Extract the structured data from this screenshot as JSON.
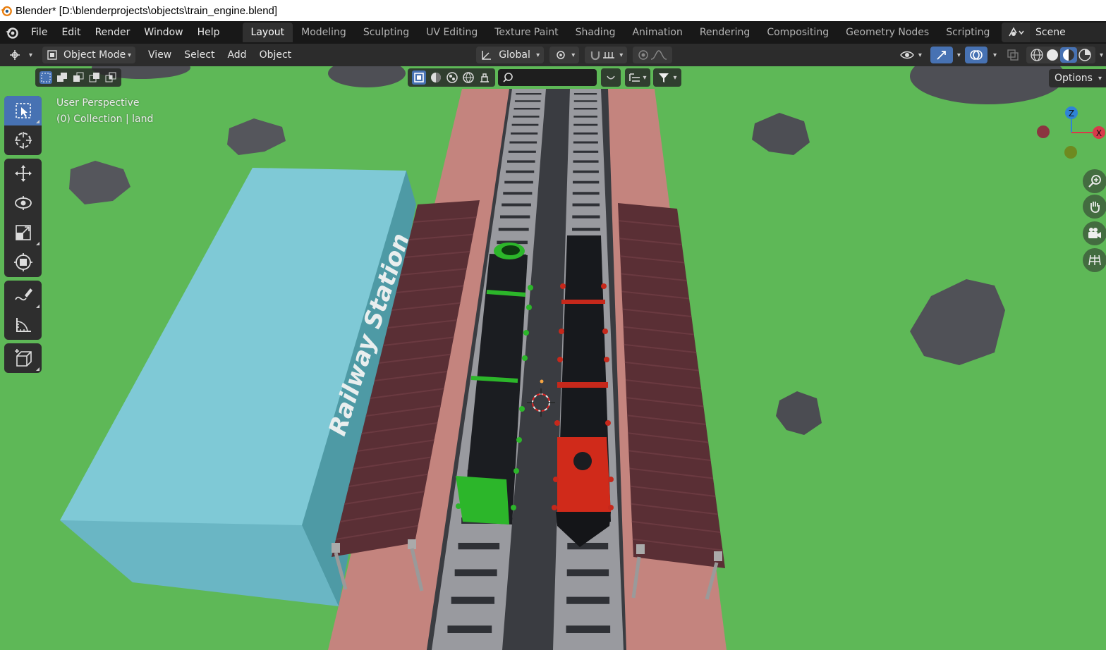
{
  "window": {
    "title": "Blender* [D:\\blenderprojects\\objects\\train_engine.blend]"
  },
  "menu": {
    "items": [
      "File",
      "Edit",
      "Render",
      "Window",
      "Help"
    ]
  },
  "workspaces": {
    "tabs": [
      "Layout",
      "Modeling",
      "Sculpting",
      "UV Editing",
      "Texture Paint",
      "Shading",
      "Animation",
      "Rendering",
      "Compositing",
      "Geometry Nodes",
      "Scripting"
    ],
    "active": "Layout",
    "add_label": "+"
  },
  "scene": {
    "name": "Scene"
  },
  "header": {
    "mode": "Object Mode",
    "menus": [
      "View",
      "Select",
      "Add",
      "Object"
    ],
    "orientation": "Global"
  },
  "viewport": {
    "perspective_label": "User Perspective",
    "collection_label": "(0) Collection | land",
    "options_label": "Options",
    "search_placeholder": "",
    "sign_text": "Railway Station",
    "gizmo": {
      "z": "Z",
      "x": "X"
    }
  },
  "colors": {
    "accent": "#4772b3",
    "grass": "#5eb857",
    "platform": "#c4847e",
    "track": "#3d3f45",
    "station": "#7fc9d6",
    "roof": "#5a2f35",
    "green_engine": "#2cb62a",
    "red_engine": "#d02a1a"
  },
  "toolbar": {
    "tools": [
      "select-box",
      "cursor",
      "move",
      "rotate",
      "scale",
      "transform",
      "annotate",
      "measure",
      "add-cube"
    ],
    "active": "select-box"
  }
}
